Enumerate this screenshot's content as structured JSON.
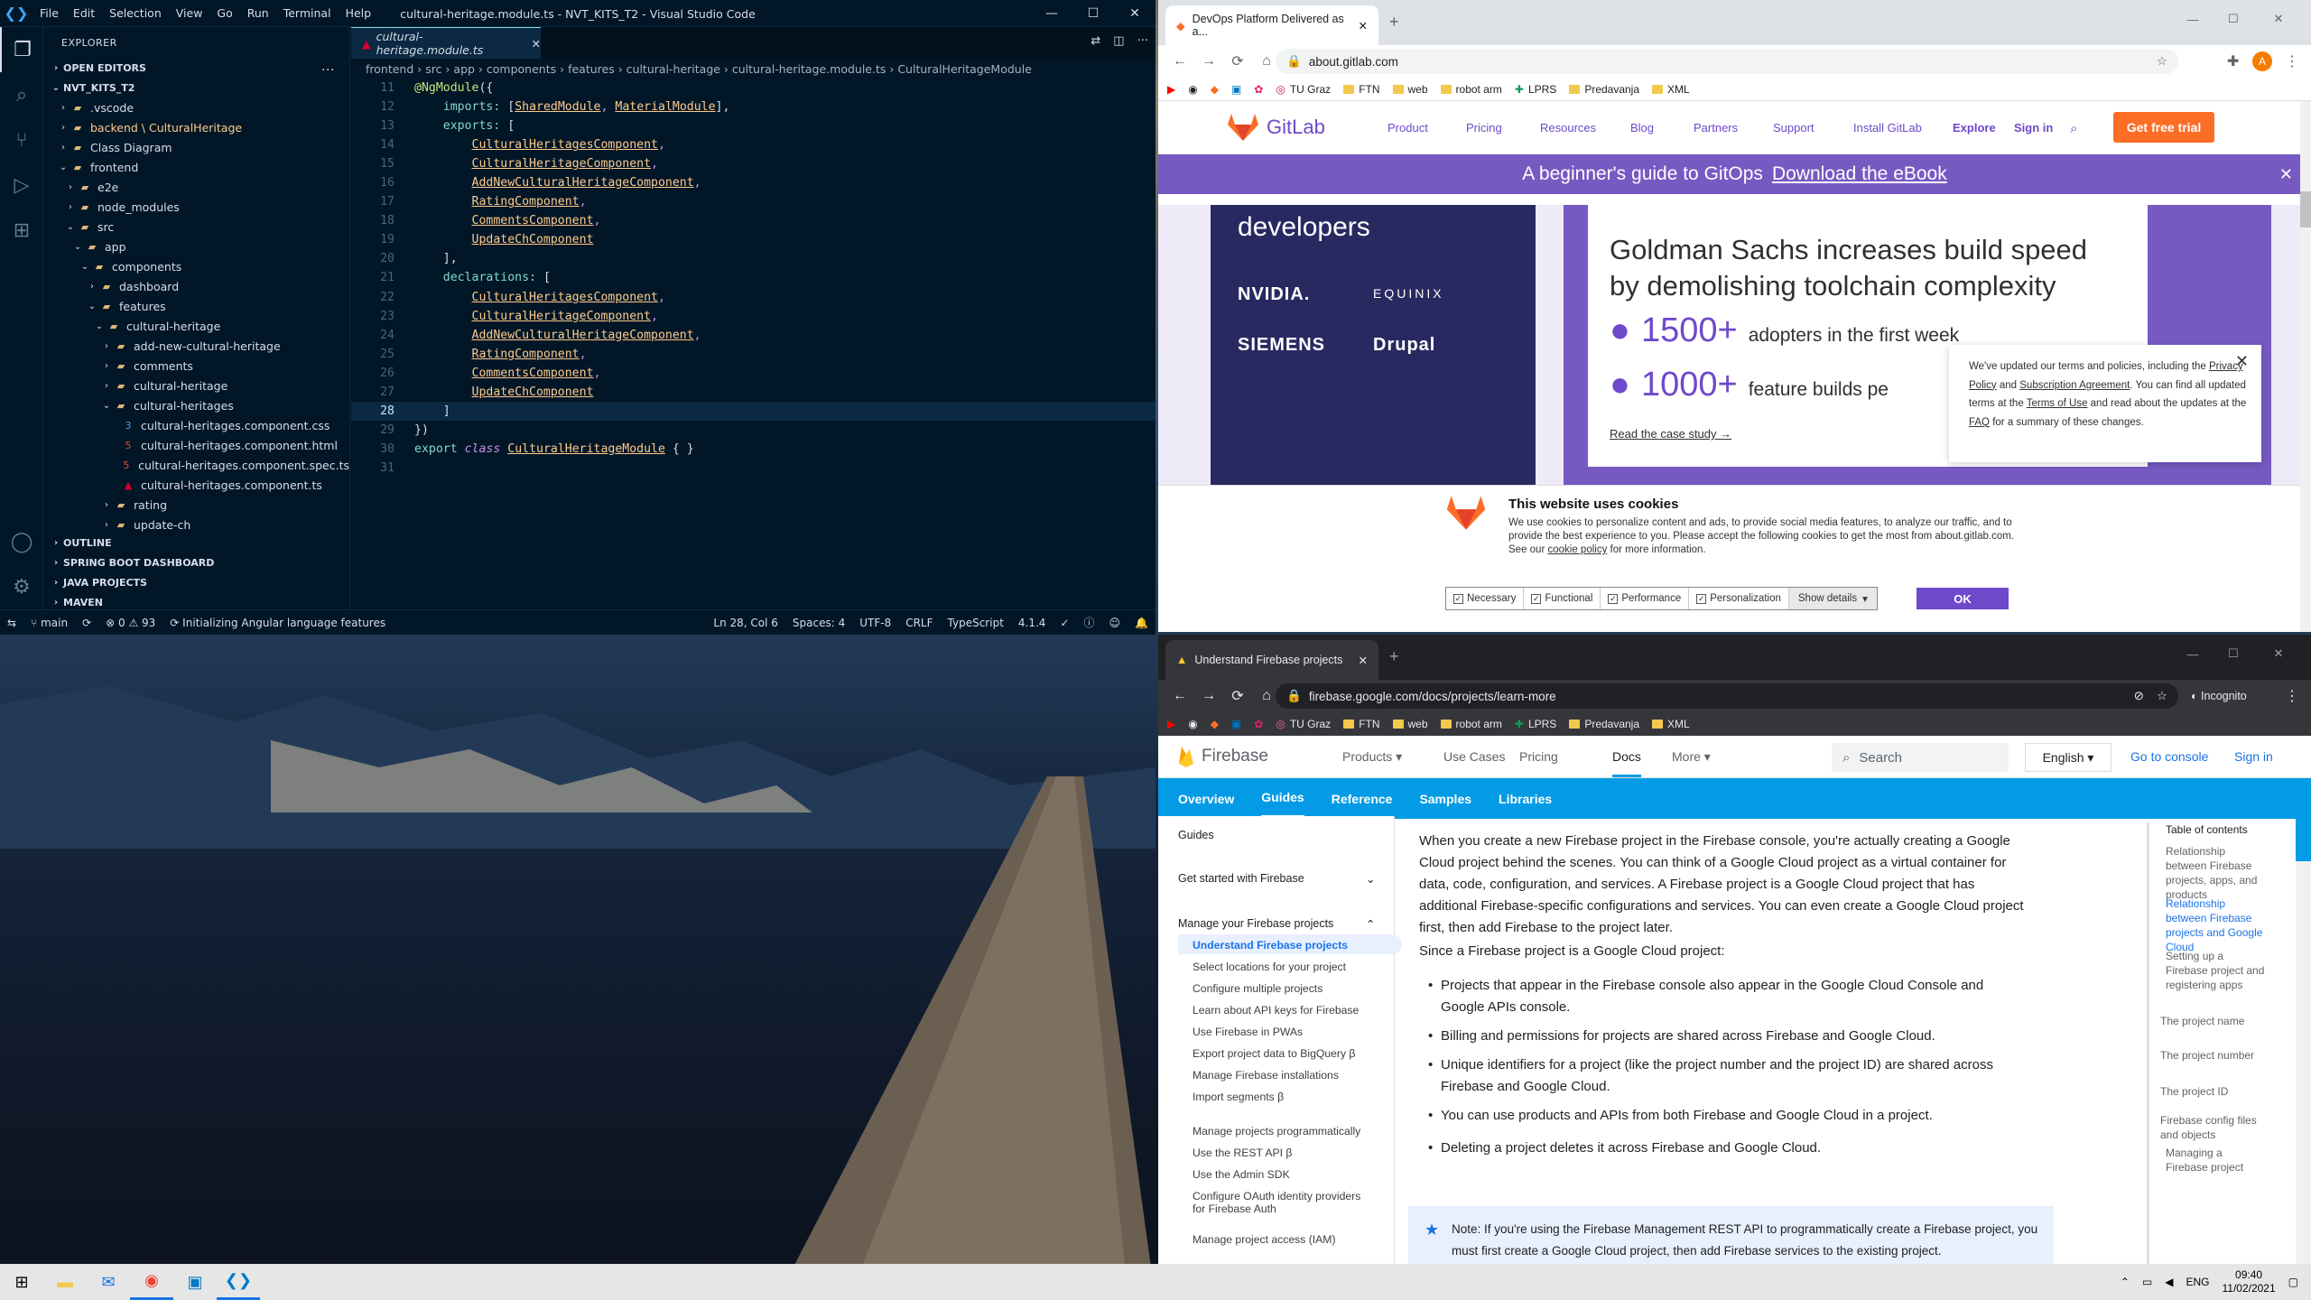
{
  "vscode": {
    "menu": [
      "File",
      "Edit",
      "Selection",
      "View",
      "Go",
      "Run",
      "Terminal",
      "Help"
    ],
    "window_title": "cultural-heritage.module.ts - NVT_KITS_T2 - Visual Studio Code",
    "explorer_label": "EXPLORER",
    "open_editors": "OPEN EDITORS",
    "workspace": "NVT_KITS_T2",
    "tree": [
      {
        "label": ".vscode",
        "depth": 1,
        "type": "folder",
        "chev": "›"
      },
      {
        "label": "backend \\ CulturalHeritage",
        "depth": 1,
        "type": "folder",
        "chev": "›"
      },
      {
        "label": "Class Diagram",
        "depth": 1,
        "type": "folder",
        "chev": "›"
      },
      {
        "label": "frontend",
        "depth": 1,
        "type": "folder",
        "chev": "⌄"
      },
      {
        "label": "e2e",
        "depth": 2,
        "type": "folder",
        "chev": "›"
      },
      {
        "label": "node_modules",
        "depth": 2,
        "type": "folder",
        "chev": "›"
      },
      {
        "label": "src",
        "depth": 2,
        "type": "folder",
        "chev": "⌄"
      },
      {
        "label": "app",
        "depth": 3,
        "type": "folder",
        "chev": "⌄"
      },
      {
        "label": "components",
        "depth": 4,
        "type": "folder",
        "chev": "⌄"
      },
      {
        "label": "dashboard",
        "depth": 5,
        "type": "folder",
        "chev": "›"
      },
      {
        "label": "features",
        "depth": 5,
        "type": "folder",
        "chev": "⌄"
      },
      {
        "label": "cultural-heritage",
        "depth": 6,
        "type": "folder",
        "chev": "⌄"
      },
      {
        "label": "add-new-cultural-heritage",
        "depth": 7,
        "type": "folder",
        "chev": "›"
      },
      {
        "label": "comments",
        "depth": 7,
        "type": "folder",
        "chev": "›"
      },
      {
        "label": "cultural-heritage",
        "depth": 7,
        "type": "folder",
        "chev": "›"
      },
      {
        "label": "cultural-heritages",
        "depth": 7,
        "type": "folder",
        "chev": "⌄"
      },
      {
        "label": "cultural-heritages.component.css",
        "depth": 8,
        "type": "css",
        "chev": ""
      },
      {
        "label": "cultural-heritages.component.html",
        "depth": 8,
        "type": "html",
        "chev": ""
      },
      {
        "label": "cultural-heritages.component.spec.ts",
        "depth": 8,
        "type": "spec",
        "chev": ""
      },
      {
        "label": "cultural-heritages.component.ts",
        "depth": 8,
        "type": "ng",
        "chev": ""
      },
      {
        "label": "rating",
        "depth": 7,
        "type": "folder",
        "chev": "›"
      },
      {
        "label": "update-ch",
        "depth": 7,
        "type": "folder",
        "chev": "›"
      }
    ],
    "sections": [
      "OUTLINE",
      "SPRING BOOT DASHBOARD",
      "JAVA PROJECTS",
      "MAVEN"
    ],
    "tab_label": "cultural-heritage.module.ts",
    "breadcrumb": "frontend › src › app › components › features › cultural-heritage › cultural-heritage.module.ts › CulturalHeritageModule",
    "code_lines": [
      {
        "n": "11",
        "html": "<span class=\"c-dec\">@NgModule</span><span class=\"c-brk\">({</span>"
      },
      {
        "n": "12",
        "html": "    <span class=\"c-kw\">imports:</span> <span class=\"c-brk\">[</span><span class=\"c-ident\">SharedModule</span><span class=\"c-punc\">,</span> <span class=\"c-ident\">MaterialModule</span><span class=\"c-brk\">],</span>"
      },
      {
        "n": "13",
        "html": "    <span class=\"c-kw\">exports:</span> <span class=\"c-brk\">[</span>"
      },
      {
        "n": "14",
        "html": "        <span class=\"c-ident\">CulturalHeritagesComponent</span><span class=\"c-punc\">,</span>"
      },
      {
        "n": "15",
        "html": "        <span class=\"c-ident\">CulturalHeritageComponent</span><span class=\"c-punc\">,</span>"
      },
      {
        "n": "16",
        "html": "        <span class=\"c-ident\">AddNewCulturalHeritageComponent</span><span class=\"c-punc\">,</span>"
      },
      {
        "n": "17",
        "html": "        <span class=\"c-ident\">RatingComponent</span><span class=\"c-punc\">,</span>"
      },
      {
        "n": "18",
        "html": "        <span class=\"c-ident\">CommentsComponent</span><span class=\"c-punc\">,</span>"
      },
      {
        "n": "19",
        "html": "        <span class=\"c-ident\">UpdateChComponent</span>"
      },
      {
        "n": "20",
        "html": "    <span class=\"c-brk\">],</span>"
      },
      {
        "n": "21",
        "html": "    <span class=\"c-kw\">declarations:</span> <span class=\"c-brk\">[</span>"
      },
      {
        "n": "22",
        "html": "        <span class=\"c-ident\">CulturalHeritagesComponent</span><span class=\"c-punc\">,</span>"
      },
      {
        "n": "23",
        "html": "        <span class=\"c-ident\">CulturalHeritageComponent</span><span class=\"c-punc\">,</span>"
      },
      {
        "n": "24",
        "html": "        <span class=\"c-ident\">AddNewCulturalHeritageComponent</span><span class=\"c-punc\">,</span>"
      },
      {
        "n": "25",
        "html": "        <span class=\"c-ident\">RatingComponent</span><span class=\"c-punc\">,</span>"
      },
      {
        "n": "26",
        "html": "        <span class=\"c-ident\">CommentsComponent</span><span class=\"c-punc\">,</span>"
      },
      {
        "n": "27",
        "html": "        <span class=\"c-ident\">UpdateChComponent</span>"
      },
      {
        "n": "28",
        "html": "    <span class=\"c-brk\">]</span>",
        "current": true
      },
      {
        "n": "29",
        "html": "<span class=\"c-brk\">})</span>"
      },
      {
        "n": "30",
        "html": "<span class=\"c-kw\">export</span> <span class=\"c-italic\">class</span> <span class=\"c-ident\">CulturalHeritageModule</span> <span class=\"c-brk\">{ }</span>"
      },
      {
        "n": "31",
        "html": ""
      }
    ],
    "status": {
      "branch": "main",
      "problems": "⊗ 0 ⚠ 93",
      "task": "Initializing Angular language features",
      "position": "Ln 28, Col 6",
      "spaces": "Spaces: 4",
      "encoding": "UTF-8",
      "eol": "CRLF",
      "lang": "TypeScript",
      "version": "4.1.4"
    }
  },
  "gitlab_browser": {
    "tab_title": "DevOps Platform Delivered as a...",
    "url": "about.gitlab.com",
    "bookmarks": [
      "TU Graz",
      "FTN",
      "web",
      "robot arm",
      "LPRS",
      "Predavanja",
      "XML"
    ],
    "logo_text": "GitLab",
    "nav": [
      "Product",
      "Pricing",
      "Resources",
      "Blog",
      "Partners",
      "Support",
      "Install GitLab",
      "Explore",
      "Sign in"
    ],
    "trial": "Get free trial",
    "banner_text": "A beginner's guide to GitOps",
    "banner_link": "Download the eBook",
    "dev_text": "developers",
    "logos": [
      "NVIDIA.",
      "EQUINIX",
      "SIEMENS",
      "Drupal"
    ],
    "card_title": "Goldman Sachs increases build speed by demolishing toolchain complexity",
    "stat1_num": "1500+",
    "stat1_txt": "adopters in the first week",
    "stat2_num": "1000+",
    "stat2_txt": "feature builds pe",
    "case_link": "Read the case study →",
    "terms": {
      "t1": "We've updated our terms and policies, including the ",
      "privacy": "Privacy Policy",
      "and": " and ",
      "sub": "Subscription Agreement",
      "t2": ". You can find all updated terms at the ",
      "tou": "Terms of Use",
      "t3": " and read about the updates at the ",
      "faq": "FAQ",
      "t4": " for a summary of these changes."
    },
    "cookie": {
      "title": "This website uses cookies",
      "body": "We use cookies to personalize content and ads, to provide social media features, to analyze our traffic, and to provide the best experience to you. Please accept the following cookies to get the most from about.gitlab.com. See our ",
      "policy": "cookie policy",
      "body_end": " for more information.",
      "options": [
        "Necessary",
        "Functional",
        "Performance",
        "Personalization"
      ],
      "details": "Show details",
      "ok": "OK"
    }
  },
  "firebase_browser": {
    "tab_title": "Understand Firebase projects",
    "url": "firebase.google.com/docs/projects/learn-more",
    "incognito": "Incognito",
    "bookmarks": [
      "TU Graz",
      "FTN",
      "web",
      "robot arm",
      "LPRS",
      "Predavanja",
      "XML"
    ],
    "logo_text": "Firebase",
    "nav": [
      "Products",
      "Use Cases",
      "Pricing",
      "Docs",
      "More"
    ],
    "search_placeholder": "Search",
    "lang": "English",
    "console": "Go to console",
    "signin": "Sign in",
    "tabs": [
      "Overview",
      "Guides",
      "Reference",
      "Samples",
      "Libraries"
    ],
    "leftnav": {
      "guides": "Guides",
      "get_started": "Get started with Firebase",
      "manage": "Manage your Firebase projects",
      "items": [
        "Understand Firebase projects",
        "Select locations for your project",
        "Configure multiple projects",
        "Learn about API keys for Firebase",
        "Use Firebase in PWAs",
        "Export project data to BigQuery  β",
        "Manage Firebase installations",
        "Import segments  β",
        "Manage projects programmatically",
        "Use the REST API  β",
        "Use the Admin SDK",
        "Configure OAuth identity providers for Firebase Auth",
        "Manage project access (IAM)"
      ]
    },
    "para1": "When you create a new Firebase project in the Firebase console, you're actually creating a Google Cloud project behind the scenes. You can think of a Google Cloud project as a virtual container for data, code, configuration, and services. A Firebase project is a Google Cloud project that has additional Firebase-specific configurations and services. You can even create a Google Cloud project first, then add Firebase to the project later.",
    "para2": "Since a Firebase project is a Google Cloud project:",
    "bullets": [
      "Projects that appear in the Firebase console also appear in the Google Cloud Console and Google APIs console.",
      "Billing and permissions for projects are shared across Firebase and Google Cloud.",
      "Unique identifiers for a project (like the project number and the project ID) are shared across Firebase and Google Cloud.",
      "You can use products and APIs from both Firebase and Google Cloud in a project.",
      "Deleting a project deletes it across Firebase and Google Cloud."
    ],
    "note": "Note: If you're using the Firebase Management REST API to programmatically create a Firebase project, you must first create a Google Cloud project, then add Firebase services to the existing project.",
    "toc_title": "Table of contents",
    "toc": [
      "Relationship between Firebase projects, apps, and products",
      "Relationship between Firebase projects and Google Cloud",
      "Setting up a Firebase project and registering apps",
      "The project name",
      "The project number",
      "The project ID",
      "Firebase config files and objects",
      "Managing a Firebase project"
    ]
  },
  "taskbar": {
    "lang": "ENG",
    "time": "09:40",
    "date": "11/02/2021"
  }
}
